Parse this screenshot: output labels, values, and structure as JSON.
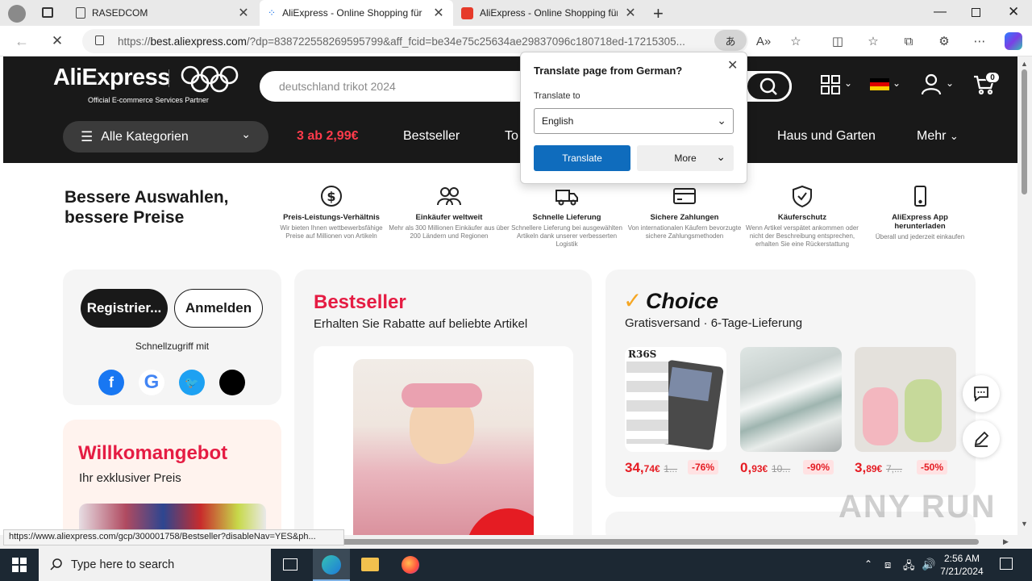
{
  "browser": {
    "tabs": [
      {
        "title": "RASEDCOM",
        "active": false
      },
      {
        "title": "AliExpress - Online Shopping für",
        "active": true
      },
      {
        "title": "AliExpress - Online Shopping für",
        "active": false
      }
    ],
    "url_prefix": "https://",
    "url_host": "best.aliexpress.com",
    "url_rest": "/?dp=838722558269595799&aff_fcid=be34e75c25634ae29837096c180718ed-17215305...",
    "status_url": "https://www.aliexpress.com/gcp/300001758/Bestseller?disableNav=YES&ph..."
  },
  "translate_popup": {
    "title": "Translate page from German?",
    "translate_to_label": "Translate to",
    "language": "English",
    "translate_button": "Translate",
    "more_button": "More"
  },
  "header": {
    "logo": "AliExpress",
    "logo_sub": "Official E-commerce Services Partner",
    "search_placeholder": "deutschland trikot 2024",
    "cart_count": "0",
    "nav": {
      "categories": "Alle Kategorien",
      "promo": "3 ab 2,99€",
      "bestseller": "Bestseller",
      "top_partial": "To",
      "home_garden": "Haus und Garten",
      "more": "Mehr"
    }
  },
  "benefits": {
    "headline_1": "Bessere Auswahlen,",
    "headline_2": "bessere Preise",
    "items": [
      {
        "title": "Preis-Leistungs-Verhältnis",
        "desc": "Wir bieten Ihnen wettbewerbsfähige Preise auf Millionen von Artikeln",
        "icon": "dollar-icon"
      },
      {
        "title": "Einkäufer weltweit",
        "desc": "Mehr als 300 Millionen Einkäufer aus über 200 Ländern und Regionen",
        "icon": "users-icon"
      },
      {
        "title": "Schnelle Lieferung",
        "desc": "Schnellere Lieferung bei ausgewählten Artikeln dank unserer verbesserten Logistik",
        "icon": "truck-icon"
      },
      {
        "title": "Sichere Zahlungen",
        "desc": "Von internationalen Käufern bevorzugte sichere Zahlungsmethoden",
        "icon": "card-icon"
      },
      {
        "title": "Käuferschutz",
        "desc": "Wenn Artikel verspätet ankommen oder nicht der Beschreibung entsprechen, erhalten Sie eine Rückerstattung",
        "icon": "shield-icon"
      },
      {
        "title": "AliExpress App herunterladen",
        "desc": "Überall und jederzeit einkaufen",
        "icon": "phone-icon"
      }
    ]
  },
  "login": {
    "register": "Registrier...",
    "signin": "Anmelden",
    "quick_access": "Schnellzugriff mit"
  },
  "welcome": {
    "title": "Willkomangebot",
    "subtitle": "Ihr exklusiver Preis"
  },
  "bestseller": {
    "title": "Bestseller",
    "subtitle": "Erhalten Sie Rabatte auf beliebte Artikel"
  },
  "choice": {
    "title": "Choice",
    "subtitle": "Gratisversand · 6-Tage-Lieferung",
    "products": [
      {
        "label": "R36S",
        "price_int": "34,",
        "price_dec": "74€",
        "old": "1...",
        "discount": "-76%"
      },
      {
        "label": "",
        "price_int": "0,",
        "price_dec": "93€",
        "old": "10...",
        "discount": "-90%"
      },
      {
        "label": "",
        "price_int": "3,",
        "price_dec": "89€",
        "old": "7,...",
        "discount": "-50%"
      }
    ]
  },
  "taskbar": {
    "search_placeholder": "Type here to search",
    "time": "2:56 AM",
    "date": "7/21/2024"
  },
  "watermark": "ANY RUN"
}
